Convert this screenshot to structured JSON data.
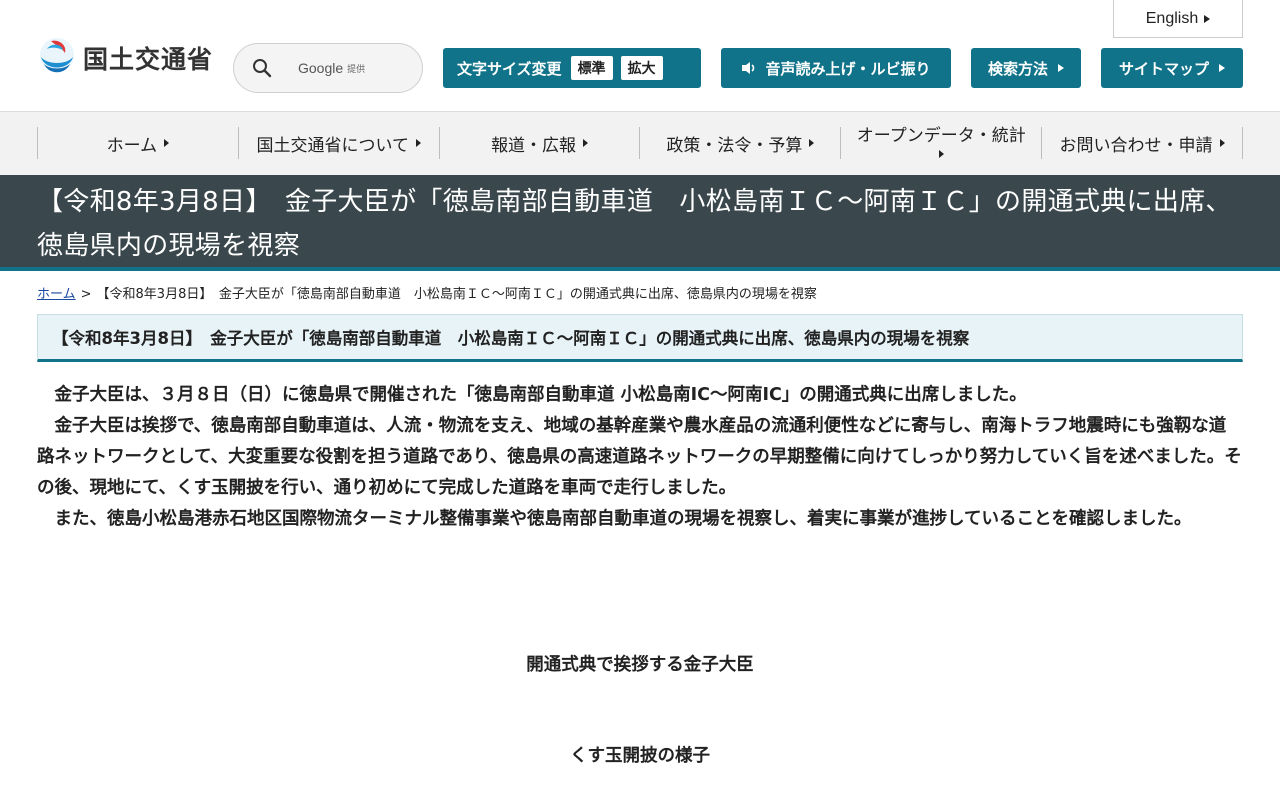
{
  "header": {
    "logo_text": "国土交通省",
    "search": {
      "provider": "Google",
      "provided_by": "提供"
    },
    "language_button": "English",
    "font_size": {
      "label": "文字サイズ変更",
      "standard": "標準",
      "enlarge": "拡大"
    },
    "voice_button": "音声読み上げ・ルビ振り",
    "search_method_button": "検索方法",
    "sitemap_button": "サイトマップ",
    "accent_color": "#117389"
  },
  "global_nav": [
    {
      "label": "ホーム"
    },
    {
      "label": "国土交通省について"
    },
    {
      "label": "報道・広報"
    },
    {
      "label": "政策・法令・予算"
    },
    {
      "label": "オープンデータ・統計"
    },
    {
      "label": "お問い合わせ・申請"
    }
  ],
  "page_title": "【令和8年3月8日】　金子大臣が「徳島南部自動車道　小松島南ＩＣ～阿南ＩＣ」の開通式典に出席、徳島県内の現場を視察",
  "breadcrumb": {
    "home": "ホーム",
    "separator": ">",
    "current": "【令和8年3月8日】　金子大臣が「徳島南部自動車道　小松島南ＩＣ～阿南ＩＣ」の開通式典に出席、徳島県内の現場を視察"
  },
  "article": {
    "heading": "【令和8年3月8日】　金子大臣が「徳島南部自動車道　小松島南ＩＣ～阿南ＩＣ」の開通式典に出席、徳島県内の現場を視察",
    "paragraphs": [
      "金子大臣は、３月８日（日）に徳島県で開催された「徳島南部自動車道 小松島南IC～阿南IC」の開通式典に出席しました。",
      "金子大臣は挨拶で、徳島南部自動車道は、人流・物流を支え、地域の基幹産業や農水産品の流通利便性などに寄与し、南海トラフ地震時にも強靱な道路ネットワークとして、大変重要な役割を担う道路であり、徳島県の高速道路ネットワークの早期整備に向けてしっかり努力していく旨を述べました。その後、現地にて、くす玉開披を行い、通り初めにて完成した道路を車両で走行しました。",
      "また、徳島小松島港赤石地区国際物流ターミナル整備事業や徳島南部自動車道の現場を視察し、着実に事業が進捗していることを確認しました。"
    ],
    "captions": [
      "開通式典で挨拶する金子大臣",
      "くす玉開披の様子"
    ]
  }
}
